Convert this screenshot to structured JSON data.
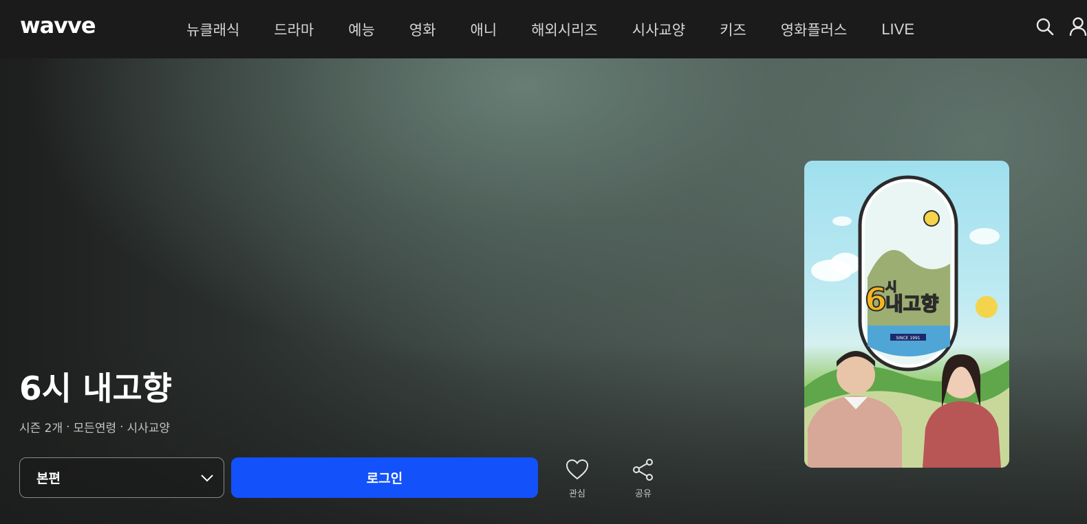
{
  "header": {
    "logo": "wavve",
    "nav": [
      "뉴클래식",
      "드라마",
      "예능",
      "영화",
      "애니",
      "해외시리즈",
      "시사교양",
      "키즈",
      "영화플러스",
      "LIVE"
    ],
    "icons": {
      "search": "search-icon",
      "user": "user-icon"
    }
  },
  "hero": {
    "title": "6시 내고향",
    "meta": {
      "seasons": "시즌 2개",
      "rating": "모든연령",
      "genre": "시사교양"
    },
    "episode_select": {
      "label": "본편"
    },
    "login_label": "로그인",
    "actions": {
      "like": "관심",
      "share": "공유"
    },
    "poster": {
      "logo_number": "6",
      "logo_si": "시",
      "logo_text": "내고향",
      "since": "SINCE 1991"
    }
  },
  "colors": {
    "header_bg": "#1b1b1b",
    "login_button": "#1351fa",
    "text_primary": "#ffffff",
    "text_secondary": "#c4c4c4"
  }
}
